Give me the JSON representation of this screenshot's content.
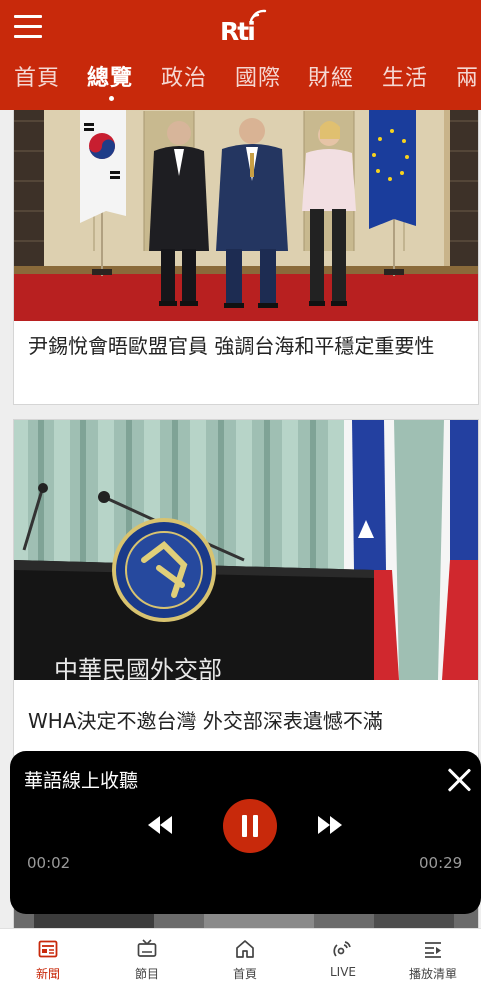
{
  "header": {
    "logo_text": "Rti",
    "tabs": [
      {
        "label": "首頁",
        "active": false
      },
      {
        "label": "總覽",
        "active": true
      },
      {
        "label": "政治",
        "active": false
      },
      {
        "label": "國際",
        "active": false
      },
      {
        "label": "財經",
        "active": false
      },
      {
        "label": "生活",
        "active": false
      },
      {
        "label": "兩",
        "active": false
      }
    ]
  },
  "feed": {
    "articles": [
      {
        "title": "尹錫悅會晤歐盟官員 強調台海和平穩定重要性"
      },
      {
        "title": "WHA決定不邀台灣 外交部深表遺憾不滿"
      }
    ],
    "photo_caption_text": "中華民國外交部"
  },
  "player": {
    "title": "華語線上收聽",
    "current_time": "00:02",
    "total_time": "00:29",
    "state": "playing"
  },
  "bottom_nav": {
    "items": [
      {
        "label": "新聞",
        "icon": "news-icon",
        "active": true
      },
      {
        "label": "節目",
        "icon": "tv-icon",
        "active": false
      },
      {
        "label": "首頁",
        "icon": "home-icon",
        "active": false
      },
      {
        "label": "LIVE",
        "icon": "live-broadcast-icon",
        "active": false
      },
      {
        "label": "播放清單",
        "icon": "playlist-icon",
        "active": false
      }
    ]
  },
  "colors": {
    "brand": "#c8290b",
    "player_bg": "#000000",
    "page_bg": "#eeeeee"
  }
}
